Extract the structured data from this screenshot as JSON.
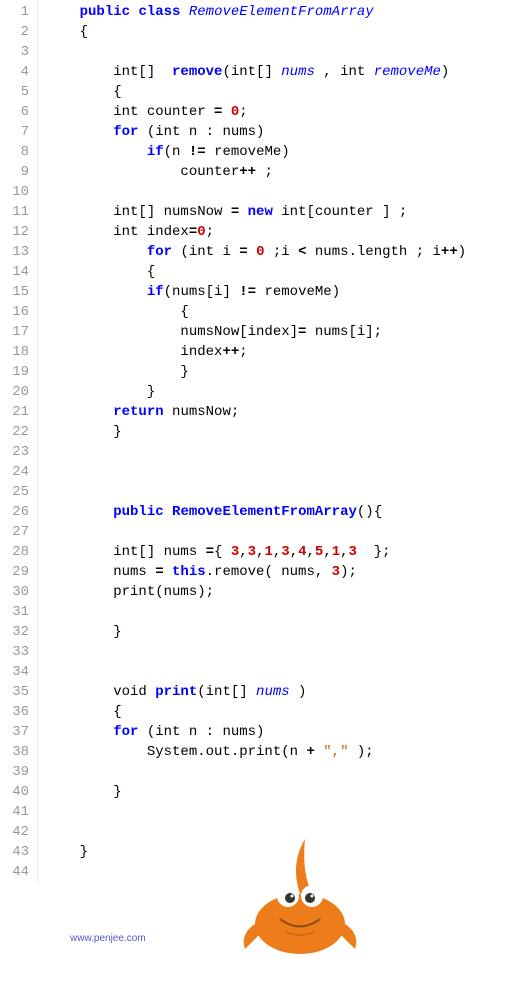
{
  "code": {
    "lines": [
      {
        "num": "1",
        "tokens": [
          {
            "t": "    ",
            "c": "plain"
          },
          {
            "t": "public",
            "c": "kw"
          },
          {
            "t": " ",
            "c": "plain"
          },
          {
            "t": "class",
            "c": "kw"
          },
          {
            "t": " ",
            "c": "plain"
          },
          {
            "t": "RemoveElementFromArray",
            "c": "cls"
          }
        ]
      },
      {
        "num": "2",
        "tokens": [
          {
            "t": "    {",
            "c": "plain"
          }
        ]
      },
      {
        "num": "3",
        "tokens": [
          {
            "t": "",
            "c": "plain"
          }
        ]
      },
      {
        "num": "4",
        "tokens": [
          {
            "t": "        int[]  ",
            "c": "plain"
          },
          {
            "t": "remove",
            "c": "method"
          },
          {
            "t": "(int[] ",
            "c": "plain"
          },
          {
            "t": "nums",
            "c": "param"
          },
          {
            "t": " , int ",
            "c": "plain"
          },
          {
            "t": "removeMe",
            "c": "param"
          },
          {
            "t": ")",
            "c": "plain"
          }
        ]
      },
      {
        "num": "5",
        "tokens": [
          {
            "t": "        {",
            "c": "plain"
          }
        ]
      },
      {
        "num": "6",
        "tokens": [
          {
            "t": "        int counter ",
            "c": "plain"
          },
          {
            "t": "=",
            "c": "op"
          },
          {
            "t": " ",
            "c": "plain"
          },
          {
            "t": "0",
            "c": "num"
          },
          {
            "t": ";",
            "c": "plain"
          }
        ]
      },
      {
        "num": "7",
        "tokens": [
          {
            "t": "        ",
            "c": "plain"
          },
          {
            "t": "for",
            "c": "kw"
          },
          {
            "t": " (int n : nums)",
            "c": "plain"
          }
        ]
      },
      {
        "num": "8",
        "tokens": [
          {
            "t": "            ",
            "c": "plain"
          },
          {
            "t": "if",
            "c": "kw"
          },
          {
            "t": "(n ",
            "c": "plain"
          },
          {
            "t": "!=",
            "c": "op"
          },
          {
            "t": " removeMe)",
            "c": "plain"
          }
        ]
      },
      {
        "num": "9",
        "tokens": [
          {
            "t": "                counter",
            "c": "plain"
          },
          {
            "t": "++",
            "c": "op"
          },
          {
            "t": " ;",
            "c": "plain"
          }
        ]
      },
      {
        "num": "10",
        "tokens": [
          {
            "t": "",
            "c": "plain"
          }
        ]
      },
      {
        "num": "11",
        "tokens": [
          {
            "t": "        int[] numsNow ",
            "c": "plain"
          },
          {
            "t": "=",
            "c": "op"
          },
          {
            "t": " ",
            "c": "plain"
          },
          {
            "t": "new",
            "c": "kw"
          },
          {
            "t": " int[counter ] ;",
            "c": "plain"
          }
        ]
      },
      {
        "num": "12",
        "tokens": [
          {
            "t": "        int index",
            "c": "plain"
          },
          {
            "t": "=",
            "c": "op"
          },
          {
            "t": "0",
            "c": "num"
          },
          {
            "t": ";",
            "c": "plain"
          }
        ]
      },
      {
        "num": "13",
        "tokens": [
          {
            "t": "            ",
            "c": "plain"
          },
          {
            "t": "for",
            "c": "kw"
          },
          {
            "t": " (int i ",
            "c": "plain"
          },
          {
            "t": "=",
            "c": "op"
          },
          {
            "t": " ",
            "c": "plain"
          },
          {
            "t": "0",
            "c": "num"
          },
          {
            "t": " ;i ",
            "c": "plain"
          },
          {
            "t": "<",
            "c": "op"
          },
          {
            "t": " nums.length ; i",
            "c": "plain"
          },
          {
            "t": "++",
            "c": "op"
          },
          {
            "t": ")",
            "c": "plain"
          }
        ]
      },
      {
        "num": "14",
        "tokens": [
          {
            "t": "            {",
            "c": "plain"
          }
        ]
      },
      {
        "num": "15",
        "tokens": [
          {
            "t": "            ",
            "c": "plain"
          },
          {
            "t": "if",
            "c": "kw"
          },
          {
            "t": "(nums[i] ",
            "c": "plain"
          },
          {
            "t": "!=",
            "c": "op"
          },
          {
            "t": " removeMe)",
            "c": "plain"
          }
        ]
      },
      {
        "num": "16",
        "tokens": [
          {
            "t": "                {",
            "c": "plain"
          }
        ]
      },
      {
        "num": "17",
        "tokens": [
          {
            "t": "                numsNow[index]",
            "c": "plain"
          },
          {
            "t": "=",
            "c": "op"
          },
          {
            "t": " nums[i];",
            "c": "plain"
          }
        ]
      },
      {
        "num": "18",
        "tokens": [
          {
            "t": "                index",
            "c": "plain"
          },
          {
            "t": "++",
            "c": "op"
          },
          {
            "t": ";",
            "c": "plain"
          }
        ]
      },
      {
        "num": "19",
        "tokens": [
          {
            "t": "                }",
            "c": "plain"
          }
        ]
      },
      {
        "num": "20",
        "tokens": [
          {
            "t": "            }",
            "c": "plain"
          }
        ]
      },
      {
        "num": "21",
        "tokens": [
          {
            "t": "        ",
            "c": "plain"
          },
          {
            "t": "return",
            "c": "kw"
          },
          {
            "t": " numsNow;",
            "c": "plain"
          }
        ]
      },
      {
        "num": "22",
        "tokens": [
          {
            "t": "        }",
            "c": "plain"
          }
        ]
      },
      {
        "num": "23",
        "tokens": [
          {
            "t": "",
            "c": "plain"
          }
        ]
      },
      {
        "num": "24",
        "tokens": [
          {
            "t": "",
            "c": "plain"
          }
        ]
      },
      {
        "num": "25",
        "tokens": [
          {
            "t": "",
            "c": "plain"
          }
        ]
      },
      {
        "num": "26",
        "tokens": [
          {
            "t": "        ",
            "c": "plain"
          },
          {
            "t": "public",
            "c": "kw"
          },
          {
            "t": " ",
            "c": "plain"
          },
          {
            "t": "RemoveElementFromArray",
            "c": "method"
          },
          {
            "t": "(){",
            "c": "plain"
          }
        ]
      },
      {
        "num": "27",
        "tokens": [
          {
            "t": "",
            "c": "plain"
          }
        ]
      },
      {
        "num": "28",
        "tokens": [
          {
            "t": "        int[] nums ",
            "c": "plain"
          },
          {
            "t": "=",
            "c": "op"
          },
          {
            "t": "{ ",
            "c": "plain"
          },
          {
            "t": "3",
            "c": "num"
          },
          {
            "t": ",",
            "c": "plain"
          },
          {
            "t": "3",
            "c": "num"
          },
          {
            "t": ",",
            "c": "plain"
          },
          {
            "t": "1",
            "c": "num"
          },
          {
            "t": ",",
            "c": "plain"
          },
          {
            "t": "3",
            "c": "num"
          },
          {
            "t": ",",
            "c": "plain"
          },
          {
            "t": "4",
            "c": "num"
          },
          {
            "t": ",",
            "c": "plain"
          },
          {
            "t": "5",
            "c": "num"
          },
          {
            "t": ",",
            "c": "plain"
          },
          {
            "t": "1",
            "c": "num"
          },
          {
            "t": ",",
            "c": "plain"
          },
          {
            "t": "3",
            "c": "num"
          },
          {
            "t": "  };",
            "c": "plain"
          }
        ]
      },
      {
        "num": "29",
        "tokens": [
          {
            "t": "        nums ",
            "c": "plain"
          },
          {
            "t": "=",
            "c": "op"
          },
          {
            "t": " ",
            "c": "plain"
          },
          {
            "t": "this",
            "c": "kw"
          },
          {
            "t": ".remove( nums, ",
            "c": "plain"
          },
          {
            "t": "3",
            "c": "num"
          },
          {
            "t": ");",
            "c": "plain"
          }
        ]
      },
      {
        "num": "30",
        "tokens": [
          {
            "t": "        print(nums);",
            "c": "plain"
          }
        ]
      },
      {
        "num": "31",
        "tokens": [
          {
            "t": "",
            "c": "plain"
          }
        ]
      },
      {
        "num": "32",
        "tokens": [
          {
            "t": "        }",
            "c": "plain"
          }
        ]
      },
      {
        "num": "33",
        "tokens": [
          {
            "t": "",
            "c": "plain"
          }
        ]
      },
      {
        "num": "34",
        "tokens": [
          {
            "t": "",
            "c": "plain"
          }
        ]
      },
      {
        "num": "35",
        "tokens": [
          {
            "t": "        void ",
            "c": "plain"
          },
          {
            "t": "print",
            "c": "method"
          },
          {
            "t": "(int[] ",
            "c": "plain"
          },
          {
            "t": "nums",
            "c": "param"
          },
          {
            "t": " )",
            "c": "plain"
          }
        ]
      },
      {
        "num": "36",
        "tokens": [
          {
            "t": "        {",
            "c": "plain"
          }
        ]
      },
      {
        "num": "37",
        "tokens": [
          {
            "t": "        ",
            "c": "plain"
          },
          {
            "t": "for",
            "c": "kw"
          },
          {
            "t": " (int n : nums)",
            "c": "plain"
          }
        ]
      },
      {
        "num": "38",
        "tokens": [
          {
            "t": "            System.out.print(n ",
            "c": "plain"
          },
          {
            "t": "+",
            "c": "op"
          },
          {
            "t": " ",
            "c": "plain"
          },
          {
            "t": "\",\"",
            "c": "str"
          },
          {
            "t": " );",
            "c": "plain"
          }
        ]
      },
      {
        "num": "39",
        "tokens": [
          {
            "t": "",
            "c": "plain"
          }
        ]
      },
      {
        "num": "40",
        "tokens": [
          {
            "t": "        }",
            "c": "plain"
          }
        ]
      },
      {
        "num": "41",
        "tokens": [
          {
            "t": "",
            "c": "plain"
          }
        ]
      },
      {
        "num": "42",
        "tokens": [
          {
            "t": "",
            "c": "plain"
          }
        ]
      },
      {
        "num": "43",
        "tokens": [
          {
            "t": "    }",
            "c": "plain"
          }
        ]
      },
      {
        "num": "44",
        "tokens": [
          {
            "t": "",
            "c": "plain"
          }
        ]
      }
    ]
  },
  "footer": {
    "url": "www.penjee.com"
  }
}
